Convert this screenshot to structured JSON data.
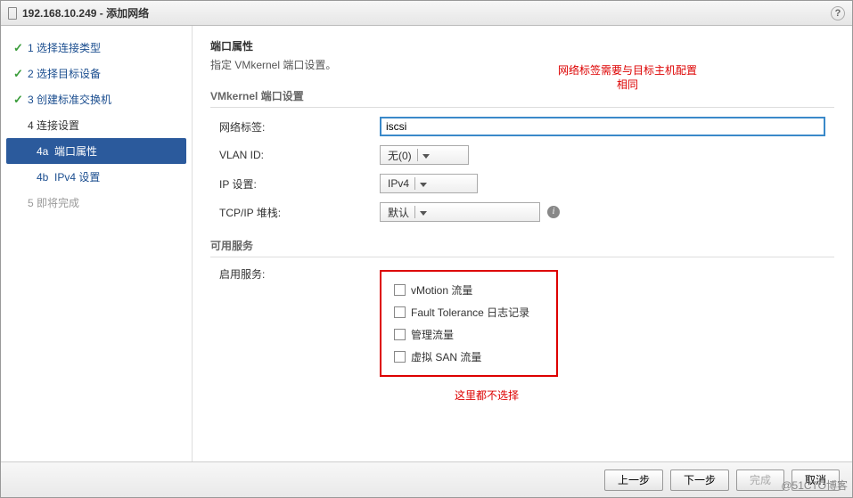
{
  "title": "192.168.10.249 - 添加网络",
  "header": {
    "title": "端口属性",
    "subtitle": "指定 VMkernel 端口设置。"
  },
  "note_top": "网络标签需要与目标主机配置\n相同",
  "sidebar": {
    "steps": [
      {
        "num": "1",
        "label": "选择连接类型",
        "done": true
      },
      {
        "num": "2",
        "label": "选择目标设备",
        "done": true
      },
      {
        "num": "3",
        "label": "创建标准交换机",
        "done": true
      },
      {
        "num": "4",
        "label": "连接设置",
        "done": false,
        "subs": [
          {
            "id": "4a",
            "label": "端口属性",
            "active": true
          },
          {
            "id": "4b",
            "label": "IPv4 设置",
            "active": false
          }
        ]
      },
      {
        "num": "5",
        "label": "即将完成",
        "pending": true
      }
    ]
  },
  "form": {
    "section_port": "VMkernel 端口设置",
    "network_label": {
      "label": "网络标签:",
      "value": "iscsi"
    },
    "vlan": {
      "label": "VLAN ID:",
      "value": "无(0)"
    },
    "ip": {
      "label": "IP 设置:",
      "value": "IPv4"
    },
    "tcpip": {
      "label": "TCP/IP 堆栈:",
      "value": "默认"
    },
    "section_service": "可用服务",
    "enable_service_label": "启用服务:",
    "services": [
      "vMotion 流量",
      "Fault Tolerance 日志记录",
      "管理流量",
      "虚拟 SAN 流量"
    ]
  },
  "note_bottom": "这里都不选择",
  "buttons": {
    "back": "上一步",
    "next": "下一步",
    "finish": "完成",
    "cancel": "取消"
  },
  "watermark": "@51CTO博客"
}
